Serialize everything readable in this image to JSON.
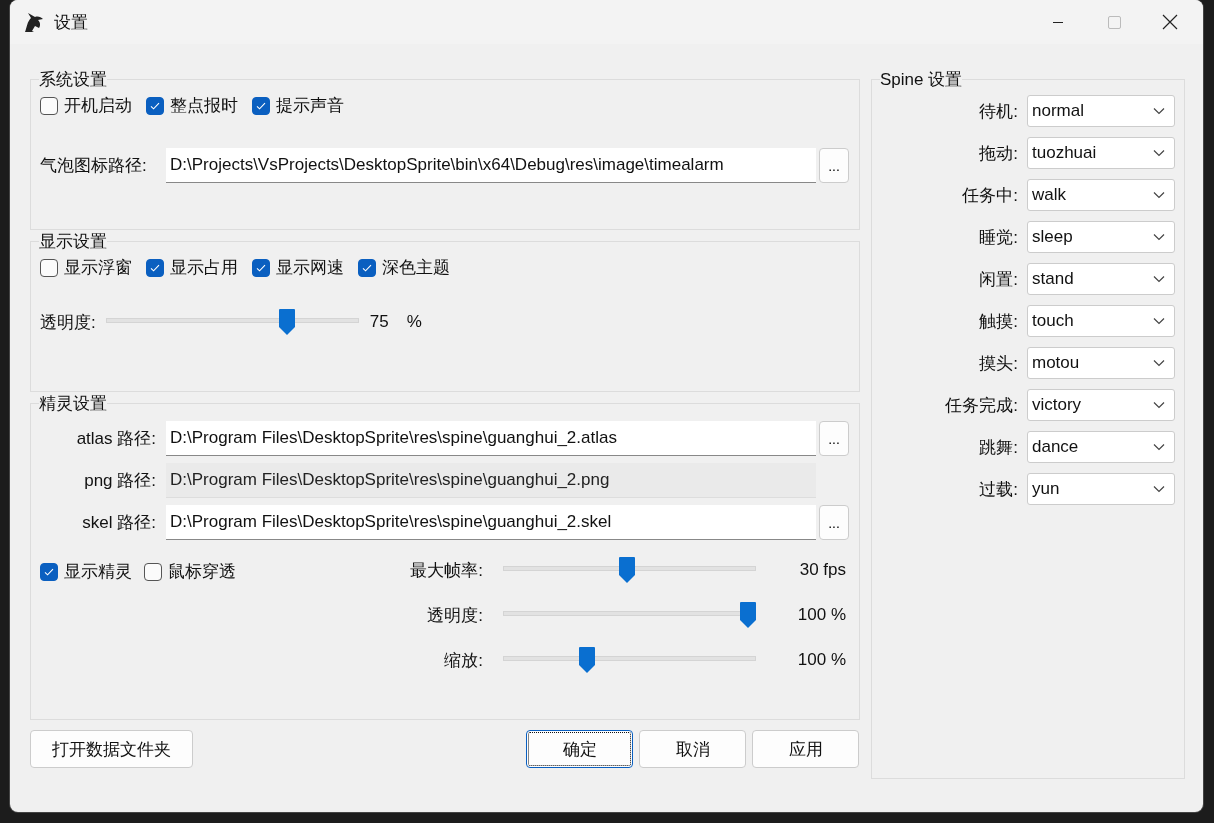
{
  "window": {
    "title": "设置"
  },
  "system": {
    "title": "系统设置",
    "checkboxes": [
      {
        "label": "开机启动",
        "checked": false
      },
      {
        "label": "整点报时",
        "checked": true
      },
      {
        "label": "提示声音",
        "checked": true
      }
    ],
    "bubble_icon_path": {
      "label": "气泡图标路径:",
      "value": "D:\\Projects\\VsProjects\\DesktopSprite\\bin\\x64\\Debug\\res\\image\\timealarm",
      "button": "..."
    }
  },
  "display": {
    "title": "显示设置",
    "checkboxes": [
      {
        "label": "显示浮窗",
        "checked": false
      },
      {
        "label": "显示占用",
        "checked": true
      },
      {
        "label": "显示网速",
        "checked": true
      },
      {
        "label": "深色主题",
        "checked": true
      }
    ],
    "opacity": {
      "label": "透明度:",
      "level": 0.73,
      "value": "75",
      "unit": "%"
    }
  },
  "sprite": {
    "title": "精灵设置",
    "paths": [
      {
        "label": "atlas 路径:",
        "value": "D:\\Program Files\\DesktopSprite\\res\\spine\\guanghui_2.atlas",
        "disabled": false,
        "button": "..."
      },
      {
        "label": "png  路径:",
        "value": "D:\\Program Files\\DesktopSprite\\res\\spine\\guanghui_2.png",
        "disabled": true
      },
      {
        "label": "skel 路径:",
        "value": "D:\\Program Files\\DesktopSprite\\res\\spine\\guanghui_2.skel",
        "disabled": false,
        "button": "..."
      }
    ],
    "checkboxes": [
      {
        "label": "显示精灵",
        "checked": true
      },
      {
        "label": "鼠标穿透",
        "checked": false
      }
    ],
    "sliders": [
      {
        "label": "最大帧率:",
        "level": 0.49,
        "reading": "30 fps"
      },
      {
        "label": "透明度:",
        "level": 1,
        "reading": "100 %"
      },
      {
        "label": "缩放:",
        "level": 0.32,
        "reading": "100 %"
      }
    ]
  },
  "spine": {
    "title": "Spine 设置",
    "rows": [
      {
        "label": "待机:",
        "value": "normal"
      },
      {
        "label": "拖动:",
        "value": "tuozhuai"
      },
      {
        "label": "任务中:",
        "value": "walk"
      },
      {
        "label": "睡觉:",
        "value": "sleep"
      },
      {
        "label": "闲置:",
        "value": "stand"
      },
      {
        "label": "触摸:",
        "value": "touch"
      },
      {
        "label": "摸头:",
        "value": "motou"
      },
      {
        "label": "任务完成:",
        "value": "victory"
      },
      {
        "label": "跳舞:",
        "value": "dance"
      },
      {
        "label": "过载:",
        "value": "yun"
      }
    ]
  },
  "open_folder_button": "打开数据文件夹",
  "dialog_buttons": [
    {
      "label": "确定",
      "focused": true
    },
    {
      "label": "取消",
      "focused": false
    },
    {
      "label": "应用",
      "focused": false
    }
  ]
}
